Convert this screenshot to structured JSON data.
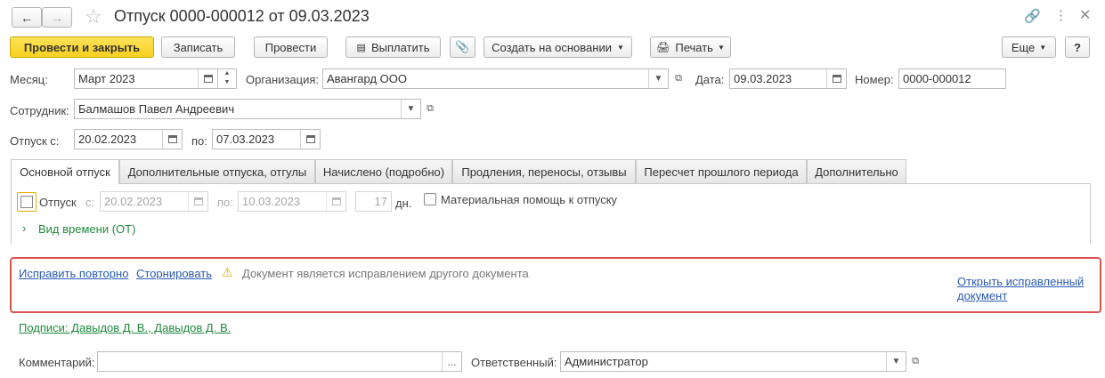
{
  "window": {
    "title": "Отпуск 0000-000012 от 09.03.2023"
  },
  "toolbar": {
    "post_close": "Провести и закрыть",
    "save": "Записать",
    "post": "Провести",
    "pay": "Выплатить",
    "create_based": "Создать на основании",
    "print": "Печать",
    "more": "Еще",
    "help": "?"
  },
  "header": {
    "month_label": "Месяц:",
    "month_value": "Март 2023",
    "org_label": "Организация:",
    "org_value": "Авангард ООО",
    "date_label": "Дата:",
    "date_value": "09.03.2023",
    "number_label": "Номер:",
    "number_value": "0000-000012",
    "employee_label": "Сотрудник:",
    "employee_value": "Балмашов Павел Андреевич",
    "vacation_from_label": "Отпуск с:",
    "vacation_from_value": "20.02.2023",
    "vacation_to_label": "по:",
    "vacation_to_value": "07.03.2023"
  },
  "tabs": [
    {
      "label": "Основной отпуск",
      "active": true
    },
    {
      "label": "Дополнительные отпуска, отгулы"
    },
    {
      "label": "Начислено (подробно)"
    },
    {
      "label": "Продления, переносы, отзывы"
    },
    {
      "label": "Пересчет прошлого периода"
    },
    {
      "label": "Дополнительно"
    }
  ],
  "main_tab": {
    "vacation_checkbox_label": "Отпуск",
    "from_label": "с:",
    "from_value": "20.02.2023",
    "to_label": "по:",
    "to_value": "10.03.2023",
    "days_value": "17",
    "days_unit": "дн.",
    "material_aid_label": "Материальная помощь к отпуску",
    "time_type_label": "Вид времени (ОТ)"
  },
  "correction": {
    "fix_again": "Исправить повторно",
    "storno": "Сторнировать",
    "warning": "Документ является исправлением другого документа",
    "open_corrected_line1": "Открыть исправленный",
    "open_corrected_line2": "документ"
  },
  "signatures": "Подписи: Давыдов Д. В., Давыдов Д. В.",
  "footer": {
    "comment_label": "Комментарий:",
    "comment_value": "",
    "responsible_label": "Ответственный:",
    "responsible_value": "Администратор"
  },
  "colors": {
    "primary_button": "#f7d01e",
    "error_border": "#d9534f",
    "link": "#2a5ab4",
    "green_link": "#1f8a3c"
  }
}
